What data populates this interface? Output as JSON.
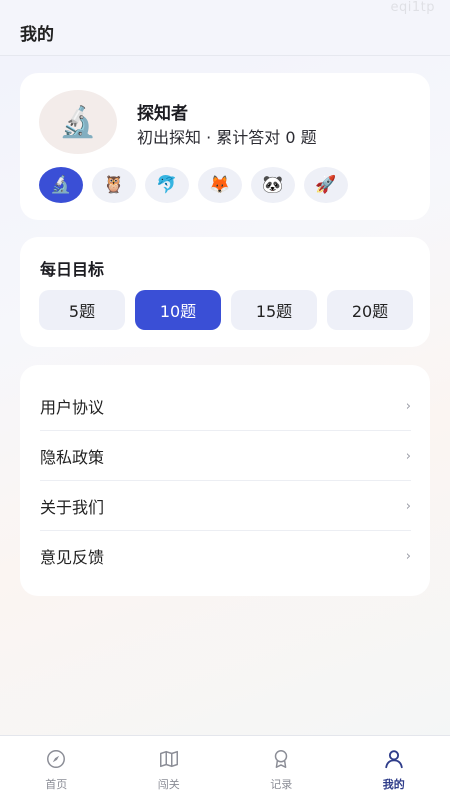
{
  "status_code": "eqi1tp",
  "header": {
    "title": "我的"
  },
  "profile": {
    "avatar_emoji": "🔬",
    "name": "探知者",
    "subtitle": "初出探知 · 累计答对 0 题",
    "avatar_options": [
      {
        "emoji": "🔬",
        "icon": "microscope-icon",
        "selected": true
      },
      {
        "emoji": "🦉",
        "icon": "owl-icon",
        "selected": false
      },
      {
        "emoji": "🐬",
        "icon": "dolphin-icon",
        "selected": false
      },
      {
        "emoji": "🦊",
        "icon": "fox-icon",
        "selected": false
      },
      {
        "emoji": "🐼",
        "icon": "panda-icon",
        "selected": false
      },
      {
        "emoji": "🚀",
        "icon": "rocket-icon",
        "selected": false
      }
    ]
  },
  "daily_goal": {
    "title": "每日目标",
    "options": [
      "5题",
      "10题",
      "15题",
      "20题"
    ],
    "selected_index": 1
  },
  "menu": {
    "items": [
      {
        "label": "用户协议",
        "chevron": "›"
      },
      {
        "label": "隐私政策",
        "chevron": "›"
      },
      {
        "label": "关于我们",
        "chevron": "›"
      },
      {
        "label": "意见反馈",
        "chevron": "›"
      }
    ]
  },
  "tabbar": {
    "tabs": [
      {
        "label": "首页",
        "icon": "compass-icon",
        "active": false
      },
      {
        "label": "闯关",
        "icon": "map-icon",
        "active": false
      },
      {
        "label": "记录",
        "icon": "medal-icon",
        "active": false
      },
      {
        "label": "我的",
        "icon": "user-icon",
        "active": true
      }
    ]
  },
  "colors": {
    "accent": "#3a4fd6",
    "active_tab": "#2f3d8a",
    "inactive_tab": "#8b8d96"
  }
}
